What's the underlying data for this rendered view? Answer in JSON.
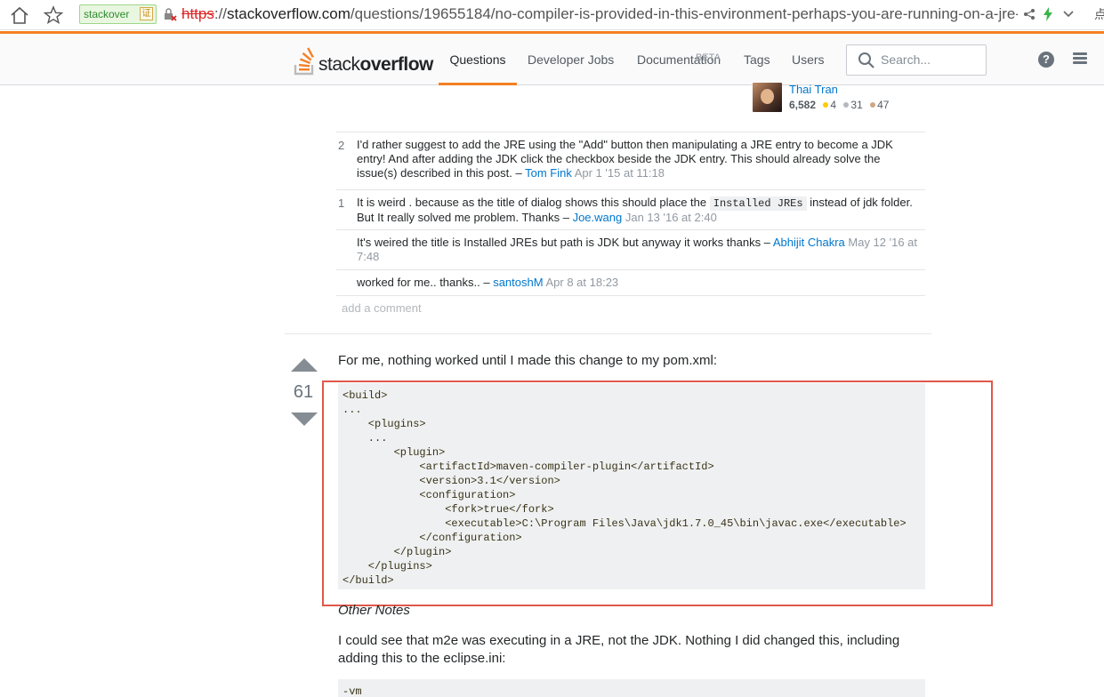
{
  "browser": {
    "site_chip": "stackover",
    "cert_label": "证",
    "url_protocol": "https",
    "url_host": "stackoverflow.com",
    "url_path": "/questions/19655184/no-compiler-is-provided-in-this-environment-perhaps-you-are-running-on-a-jre-",
    "edge_glyph": "点"
  },
  "topbar": {
    "logo_light": "stack",
    "logo_bold": "overflow",
    "nav": [
      {
        "label": "Questions"
      },
      {
        "label": "Developer Jobs"
      },
      {
        "label": "Documentation",
        "badge": "BETA"
      },
      {
        "label": "Tags"
      },
      {
        "label": "Users"
      }
    ],
    "search_placeholder": "Search...",
    "help_glyph": "?"
  },
  "user_card": {
    "name": "Thai Tran",
    "reputation": "6,582",
    "gold": "4",
    "silver": "31",
    "bronze": "47",
    "colors": {
      "gold": "#ffcc01",
      "silver": "#b4b8bc",
      "bronze": "#d1a684"
    }
  },
  "comments": [
    {
      "score": "2",
      "text": "I'd rather suggest to add the JRE using the \"Add\" button then manipulating a JRE entry to become a JDK entry! And after adding the JDK click the checkbox beside the JDK entry. This should already solve the issue(s) described in this post. –",
      "user": "Tom Fink",
      "date": "Apr 1 '15 at 11:18"
    },
    {
      "score": "1",
      "text_before": "It is weird . because as the title of dialog shows this should place the",
      "code": "Installed JREs",
      "text_after": "instead of jdk folder. But It really solved me problem. Thanks –",
      "user": "Joe.wang",
      "date": "Jan 13 '16 at 2:40"
    },
    {
      "score": "",
      "text": "It's weired the title is Installed JREs but path is JDK but anyway it works thanks –",
      "user": "Abhijit Chakra",
      "date": "May 12 '16 at 7:48"
    },
    {
      "score": "",
      "text": "worked for me.. thanks.. –",
      "user": "santoshM",
      "date": "Apr 8 at 18:23"
    }
  ],
  "add_comment": "add a comment",
  "answer": {
    "votes": "61",
    "intro": "For me, nothing worked until I made this change to my pom.xml:",
    "code": "<build>\n...\n    <plugins>\n    ...\n        <plugin>\n            <artifactId>maven-compiler-plugin</artifactId>\n            <version>3.1</version>\n            <configuration>\n                <fork>true</fork>\n                <executable>C:\\Program Files\\Java\\jdk1.7.0_45\\bin\\javac.exe</executable>\n            </configuration>\n        </plugin>\n    </plugins>\n</build>",
    "other_notes": "Other Notes",
    "paragraph": "I could see that m2e was executing in a JRE, not the JDK. Nothing I did changed this, including adding this to the eclipse.ini:",
    "code2": "-vm"
  },
  "accent_color": "#f48024",
  "highlight_color": "#e0574a"
}
